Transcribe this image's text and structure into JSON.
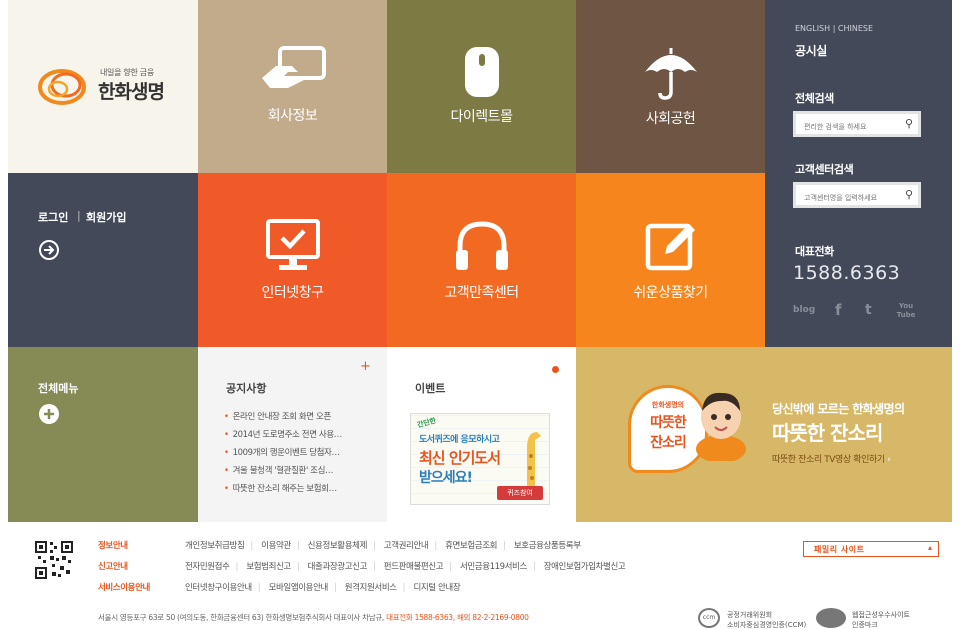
{
  "logo": {
    "tagline": "내일을 향한 금융",
    "name": "한화생명"
  },
  "tiles": {
    "company": {
      "label": "회사정보",
      "bg": "#c2ab8b",
      "icon": "handshake-card-icon"
    },
    "direct": {
      "label": "다이렉트몰",
      "bg": "#7d7a44",
      "icon": "mouse-icon"
    },
    "social": {
      "label": "사회공헌",
      "bg": "#6e5544",
      "icon": "umbrella-icon"
    },
    "internet": {
      "label": "인터넷창구",
      "bg": "#f05a28",
      "icon": "monitor-check-icon"
    },
    "customer": {
      "label": "고객만족센터",
      "bg": "#f26a21",
      "icon": "headphones-icon"
    },
    "products": {
      "label": "쉬운상품찾기",
      "bg": "#f7851d",
      "icon": "edit-pencil-icon"
    }
  },
  "right_panel": {
    "languages": "ENGLISH | CHINESE",
    "pressroom": "공시실",
    "search_heading": "전체검색",
    "search_placeholder": "편리한 검색을 하세요",
    "cs_heading": "고객센터검색",
    "cs_placeholder": "고객센터명을 입력하세요",
    "phone_heading": "대표전화",
    "phone": "1588.6363",
    "social": [
      "blog",
      "f",
      "t",
      "You Tube"
    ]
  },
  "login": {
    "login": "로그인",
    "join": "회원가입"
  },
  "menu": {
    "label": "전체메뉴"
  },
  "notice": {
    "title": "공지사항",
    "items": [
      "온라인 안내장 조회 화면 오픈",
      "2014년 도로명주소 전면 사용…",
      "1009개의 행운이벤트 당첨자…",
      "겨울 불청객 '혈관질환' 조심…",
      "따뜻한 잔소리 해주는 보험회…"
    ]
  },
  "event": {
    "title": "이벤트",
    "badge": "간단한",
    "line1": "도서퀴즈에 응모하시고",
    "line2": "최신 인기도서",
    "line3": "받으세요!",
    "button": "퀴즈참여"
  },
  "banner": {
    "bubble_top": "한화생명의",
    "bubble_mid": "따뜻한",
    "bubble_bottom": "잔소리",
    "line1": "당신밖에 모르는 한화생명의",
    "line2": "따뜻한 잔소리",
    "link": "따뜻한 잔소리 TV영상 확인하기"
  },
  "footer": {
    "cat1": "정보안내",
    "cat2": "신고안내",
    "cat3": "서비스이용안내",
    "row1": [
      "개인정보취급방침",
      "이용약관",
      "신용정보활용체제",
      "고객권리안내",
      "휴면보험금조회",
      "보호금융상품등록부"
    ],
    "row2": [
      "전자민원접수",
      "보험범죄신고",
      "대출과장광고신고",
      "펀드판매불편신고",
      "서민금융119서비스",
      "장애인보험가입차별신고"
    ],
    "row3": [
      "인터넷창구이용안내",
      "모바일앱이용안내",
      "원격지원서비스",
      "디지털 안내장"
    ],
    "family_site": "패밀리 사이트",
    "address": "서울시 영등포구 63로 50 (여의도동, 한화금융센터 63) 한화생명보험주식회사 대표이사 차남규,",
    "phones": "대표전화 1588-6363, 해외 82-2-2169-0800",
    "badge1_line1": "공정거래위원회",
    "badge1_line2": "소비자중심경영인증(CCM)",
    "badge2_line1": "웹접근성우수사이트",
    "badge2_line2": "인증마크"
  }
}
